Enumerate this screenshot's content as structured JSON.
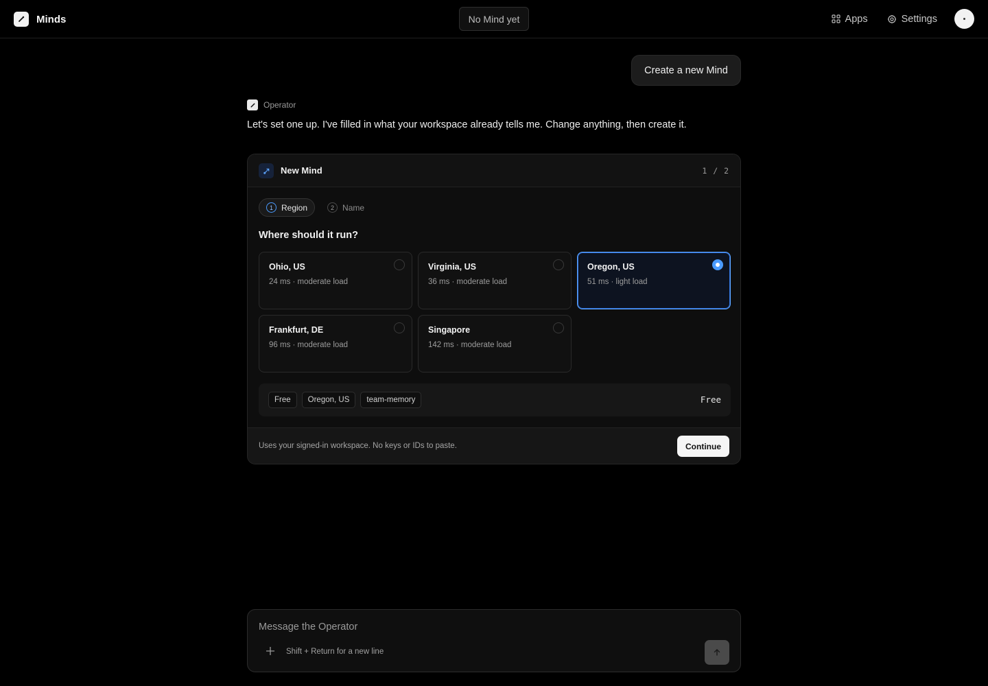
{
  "topbar": {
    "brand": "Minds",
    "mind_selector": "No Mind yet",
    "apps": "Apps",
    "settings": "Settings"
  },
  "chat": {
    "user_message": "Create a new Mind",
    "operator_name": "Operator",
    "operator_message": "Let's set one up. I've filled in what your workspace already tells me. Change anything, then create it."
  },
  "card": {
    "title": "New Mind",
    "step_counter": "1 / 2",
    "steps": [
      {
        "num": "1",
        "label": "Region",
        "active": true
      },
      {
        "num": "2",
        "label": "Name",
        "active": false
      }
    ],
    "question": "Where should it run?",
    "regions": [
      {
        "name": "Ohio, US",
        "meta": "24 ms · moderate load",
        "selected": false
      },
      {
        "name": "Virginia, US",
        "meta": "36 ms · moderate load",
        "selected": false
      },
      {
        "name": "Oregon, US",
        "meta": "51 ms · light load",
        "selected": true
      },
      {
        "name": "Frankfurt, DE",
        "meta": "96 ms · moderate load",
        "selected": false
      },
      {
        "name": "Singapore",
        "meta": "142 ms · moderate load",
        "selected": false
      }
    ],
    "summary_tags": [
      "Free",
      "Oregon, US",
      "team-memory"
    ],
    "price": "Free",
    "footer_note": "Uses your signed-in workspace. No keys or IDs to paste.",
    "continue_label": "Continue"
  },
  "composer": {
    "placeholder": "Message the Operator",
    "hint": "Shift + Return for a new line"
  },
  "colors": {
    "accent": "#4a9bff",
    "background": "#000000"
  }
}
